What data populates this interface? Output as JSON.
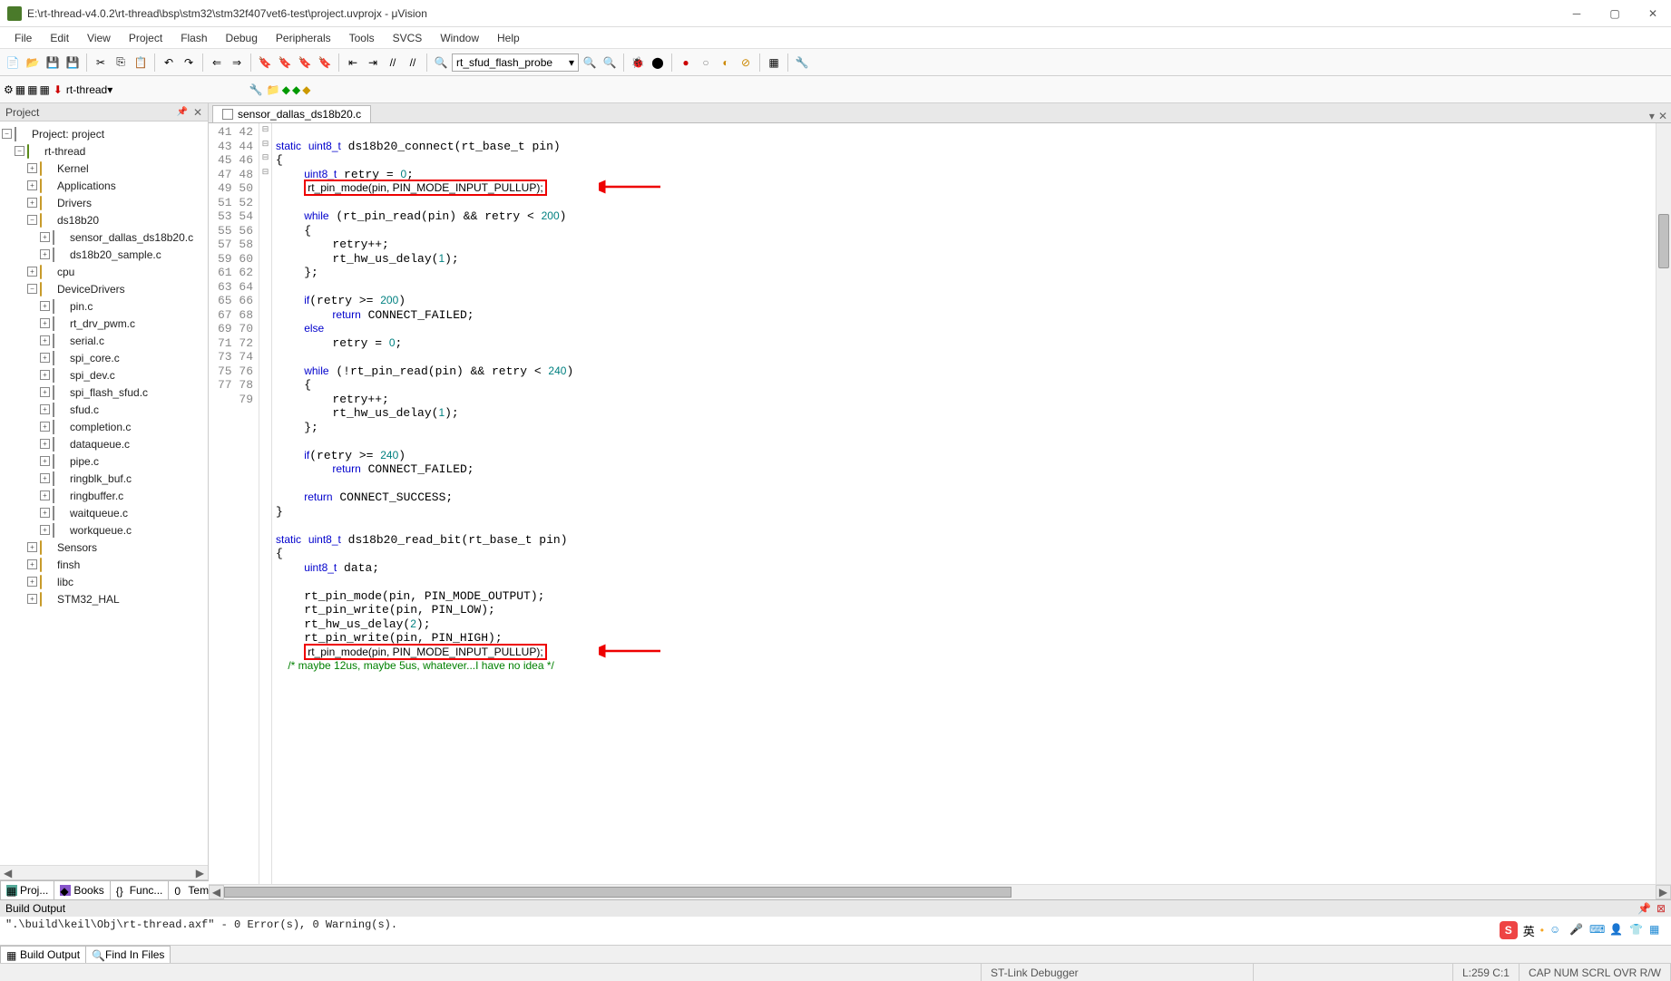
{
  "window": {
    "title": "E:\\rt-thread-v4.0.2\\rt-thread\\bsp\\stm32\\stm32f407vet6-test\\project.uvprojx - μVision"
  },
  "menu": [
    "File",
    "Edit",
    "View",
    "Project",
    "Flash",
    "Debug",
    "Peripherals",
    "Tools",
    "SVCS",
    "Window",
    "Help"
  ],
  "toolbar": {
    "combo1": "rt_sfud_flash_probe",
    "target": "rt-thread"
  },
  "project_panel": {
    "title": "Project",
    "root": "Project: project",
    "target": "rt-thread",
    "groups": [
      {
        "name": "Kernel",
        "expanded": false
      },
      {
        "name": "Applications",
        "expanded": false
      },
      {
        "name": "Drivers",
        "expanded": false
      },
      {
        "name": "ds18b20",
        "expanded": true,
        "files": [
          "sensor_dallas_ds18b20.c",
          "ds18b20_sample.c"
        ]
      },
      {
        "name": "cpu",
        "expanded": false
      },
      {
        "name": "DeviceDrivers",
        "expanded": true,
        "files": [
          "pin.c",
          "rt_drv_pwm.c",
          "serial.c",
          "spi_core.c",
          "spi_dev.c",
          "spi_flash_sfud.c",
          "sfud.c",
          "completion.c",
          "dataqueue.c",
          "pipe.c",
          "ringblk_buf.c",
          "ringbuffer.c",
          "waitqueue.c",
          "workqueue.c"
        ]
      },
      {
        "name": "Sensors",
        "expanded": false
      },
      {
        "name": "finsh",
        "expanded": false
      },
      {
        "name": "libc",
        "expanded": false
      },
      {
        "name": "STM32_HAL",
        "expanded": false
      }
    ],
    "bottom_tabs": [
      "Proj...",
      "Books",
      "Func...",
      "Tem..."
    ]
  },
  "editor": {
    "tab": "sensor_dallas_ds18b20.c",
    "lines": [
      {
        "n": 41,
        "t": ""
      },
      {
        "n": 42,
        "t": "static uint8_t ds18b20_connect(rt_base_t pin)"
      },
      {
        "n": 43,
        "t": "{"
      },
      {
        "n": 44,
        "t": "    uint8_t retry = 0;"
      },
      {
        "n": 45,
        "t": "    rt_pin_mode(pin, PIN_MODE_INPUT_PULLUP);",
        "box": true
      },
      {
        "n": 46,
        "t": ""
      },
      {
        "n": 47,
        "t": "    while (rt_pin_read(pin) && retry < 200)"
      },
      {
        "n": 48,
        "t": "    {"
      },
      {
        "n": 49,
        "t": "        retry++;"
      },
      {
        "n": 50,
        "t": "        rt_hw_us_delay(1);"
      },
      {
        "n": 51,
        "t": "    };"
      },
      {
        "n": 52,
        "t": ""
      },
      {
        "n": 53,
        "t": "    if(retry >= 200)"
      },
      {
        "n": 54,
        "t": "        return CONNECT_FAILED;"
      },
      {
        "n": 55,
        "t": "    else"
      },
      {
        "n": 56,
        "t": "        retry = 0;"
      },
      {
        "n": 57,
        "t": ""
      },
      {
        "n": 58,
        "t": "    while (!rt_pin_read(pin) && retry < 240)"
      },
      {
        "n": 59,
        "t": "    {"
      },
      {
        "n": 60,
        "t": "        retry++;"
      },
      {
        "n": 61,
        "t": "        rt_hw_us_delay(1);"
      },
      {
        "n": 62,
        "t": "    };"
      },
      {
        "n": 63,
        "t": ""
      },
      {
        "n": 64,
        "t": "    if(retry >= 240)"
      },
      {
        "n": 65,
        "t": "        return CONNECT_FAILED;"
      },
      {
        "n": 66,
        "t": ""
      },
      {
        "n": 67,
        "t": "    return CONNECT_SUCCESS;"
      },
      {
        "n": 68,
        "t": "}"
      },
      {
        "n": 69,
        "t": ""
      },
      {
        "n": 70,
        "t": "static uint8_t ds18b20_read_bit(rt_base_t pin)"
      },
      {
        "n": 71,
        "t": "{"
      },
      {
        "n": 72,
        "t": "    uint8_t data;"
      },
      {
        "n": 73,
        "t": ""
      },
      {
        "n": 74,
        "t": "    rt_pin_mode(pin, PIN_MODE_OUTPUT);"
      },
      {
        "n": 75,
        "t": "    rt_pin_write(pin, PIN_LOW);"
      },
      {
        "n": 76,
        "t": "    rt_hw_us_delay(2);"
      },
      {
        "n": 77,
        "t": "    rt_pin_write(pin, PIN_HIGH);"
      },
      {
        "n": 78,
        "t": "    rt_pin_mode(pin, PIN_MODE_INPUT_PULLUP);",
        "box": true
      },
      {
        "n": 79,
        "t": "    /* maybe 12us, maybe 5us, whatever...I have no idea */",
        "cmt": true
      }
    ]
  },
  "build_output": {
    "title": "Build Output",
    "text": "\".\\build\\keil\\Obj\\rt-thread.axf\" - 0 Error(s), 0 Warning(s).",
    "tabs": [
      "Build Output",
      "Find In Files"
    ]
  },
  "statusbar": {
    "debugger": "ST-Link Debugger",
    "pos": "L:259 C:1",
    "caps": "CAP NUM SCRL OVR R/W"
  },
  "ime": {
    "label": "英"
  }
}
